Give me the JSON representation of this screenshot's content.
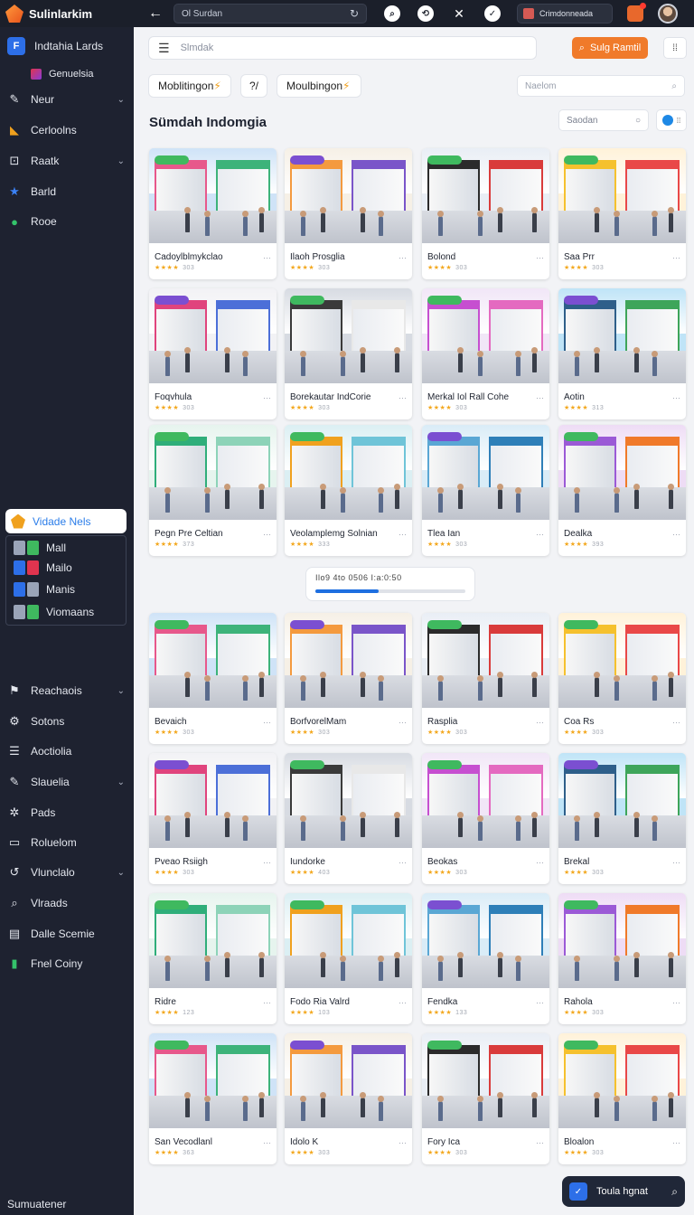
{
  "app": {
    "name": "Sulinlarkim"
  },
  "topbar": {
    "url": "Ol Surdan",
    "account": "Crimdonneada"
  },
  "icons": {
    "back": "arrow-left-icon",
    "reload": "reload-icon",
    "close": "close-icon",
    "search": "search-icon",
    "grid": "grid-icon",
    "menu": "hamburger-icon"
  },
  "sidebar": {
    "project": {
      "name": "Indtahia Lards",
      "sub": "Genuelsia"
    },
    "items": [
      {
        "label": "Neur",
        "icon": "tag-icon",
        "chevron": true
      },
      {
        "label": "Cerloolns",
        "icon": "folder-icon",
        "chevron": false
      },
      {
        "label": "Raatk",
        "icon": "box-icon",
        "chevron": true
      },
      {
        "label": "Barld",
        "icon": "star-icon",
        "chevron": false
      },
      {
        "label": "Rooe",
        "icon": "circle-icon",
        "chevron": false
      }
    ],
    "active": {
      "label": "Vidade Nels"
    },
    "sub_items": [
      {
        "label": "Mall"
      },
      {
        "label": "Mailo"
      },
      {
        "label": "Manis"
      },
      {
        "label": "Viomaans"
      }
    ],
    "items_lower": [
      {
        "label": "Reachaois",
        "chevron": true
      },
      {
        "label": "Sotons",
        "chevron": false
      },
      {
        "label": "Aoctiolia",
        "chevron": false
      },
      {
        "label": "Slauelia",
        "chevron": true
      },
      {
        "label": "Pads",
        "chevron": false
      },
      {
        "label": "Roluelom",
        "chevron": false
      },
      {
        "label": "Vlunclalo",
        "chevron": true
      },
      {
        "label": "Vlraads",
        "chevron": false
      },
      {
        "label": "Dalle Scemie",
        "chevron": false
      },
      {
        "label": "Fnel Coiny",
        "chevron": false
      }
    ],
    "footer": "Sumuatener"
  },
  "main": {
    "search_placeholder": "Slmdak",
    "action_button": "Sulg Ramtil",
    "chips": [
      "Moblitingon",
      "?/",
      "Moulbingon"
    ],
    "filter_placeholder": "Naelom",
    "title": "Sümdah Indomgia",
    "sort_label": "Saodan",
    "progress": {
      "text": "Ilo9 4to 0506 I:a:0:50",
      "value": 0.42
    },
    "chat": {
      "label": "Toula hgnat"
    }
  },
  "cards": [
    {
      "title": "Cadoylblmykclao",
      "rating": "★★★★",
      "meta": "303"
    },
    {
      "title": "Ilaoh Prosglia",
      "rating": "★★★★",
      "meta": "303"
    },
    {
      "title": "Bolond",
      "rating": "★★★★",
      "meta": "303"
    },
    {
      "title": "Saa Prr",
      "rating": "★★★★",
      "meta": "303"
    },
    {
      "title": "Foqvhula",
      "rating": "★★★★",
      "meta": "303"
    },
    {
      "title": "Borekautar IndCorie",
      "rating": "★★★★",
      "meta": "303"
    },
    {
      "title": "Merkal Iol Rall Cohe",
      "rating": "★★★★",
      "meta": "303"
    },
    {
      "title": "Aotin",
      "rating": "★★★★",
      "meta": "313"
    },
    {
      "title": "Pegn Pre Celtian",
      "rating": "★★★★",
      "meta": "373"
    },
    {
      "title": "Veolamplemg Solnian",
      "rating": "★★★★",
      "meta": "333"
    },
    {
      "title": "Tlea Ian",
      "rating": "★★★★",
      "meta": "303"
    },
    {
      "title": "Dealka",
      "rating": "★★★★",
      "meta": "393"
    },
    {
      "title": "Bevaich",
      "rating": "★★★★",
      "meta": "303"
    },
    {
      "title": "BorfvorelMam",
      "rating": "★★★★",
      "meta": "303"
    },
    {
      "title": "Rasplia",
      "rating": "★★★★",
      "meta": "303"
    },
    {
      "title": "Coa Rs",
      "rating": "★★★★",
      "meta": "303"
    },
    {
      "title": "Pveao Rsiigh",
      "rating": "★★★★",
      "meta": "303"
    },
    {
      "title": "Iundorke",
      "rating": "★★★★",
      "meta": "403"
    },
    {
      "title": "Beokas",
      "rating": "★★★★",
      "meta": "303"
    },
    {
      "title": "Brekal",
      "rating": "★★★★",
      "meta": "303"
    },
    {
      "title": "Ridre",
      "rating": "★★★★",
      "meta": "123"
    },
    {
      "title": "Fodo Ria Valrd",
      "rating": "★★★★",
      "meta": "103"
    },
    {
      "title": "Fendka",
      "rating": "★★★★",
      "meta": "133"
    },
    {
      "title": "Rahola",
      "rating": "★★★★",
      "meta": "303"
    },
    {
      "title": "San Vecodlanl",
      "rating": "★★★★",
      "meta": "363"
    },
    {
      "title": "Idolo K",
      "rating": "★★★★",
      "meta": "303"
    },
    {
      "title": "Fory Ica",
      "rating": "★★★★",
      "meta": "303"
    },
    {
      "title": "Bloalon",
      "rating": "★★★★",
      "meta": "303"
    }
  ],
  "palette": {
    "accent": "#f07a2a",
    "active_blue": "#2b7de9",
    "sidebar_bg": "#1e2230",
    "topbar_bg": "#1b1f2a",
    "star": "#f3a81f"
  }
}
